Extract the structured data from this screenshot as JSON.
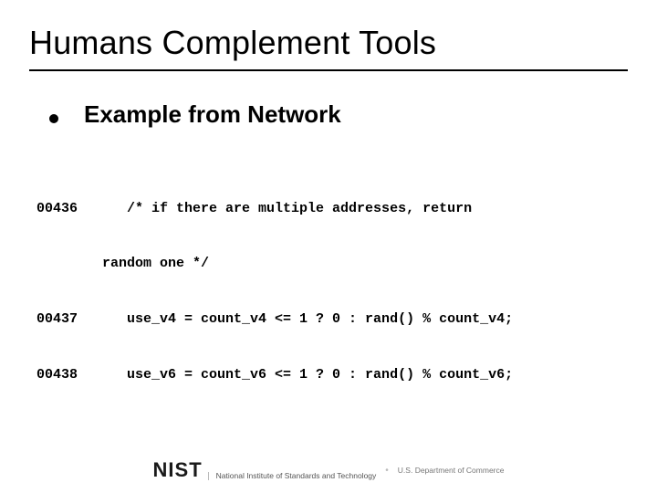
{
  "title": "Humans Complement Tools",
  "bullet": "Example from Network",
  "code": {
    "lines": [
      "00436      /* if there are multiple addresses, return",
      "        random one */",
      "00437      use_v4 = count_v4 <= 1 ? 0 : rand() % count_v4;",
      "00438      use_v6 = count_v6 <= 1 ? 0 : rand() % count_v6;"
    ]
  },
  "footer": {
    "logo_text": "NIST",
    "org": "National Institute of Standards and Technology",
    "dept": "U.S. Department of Commerce"
  }
}
